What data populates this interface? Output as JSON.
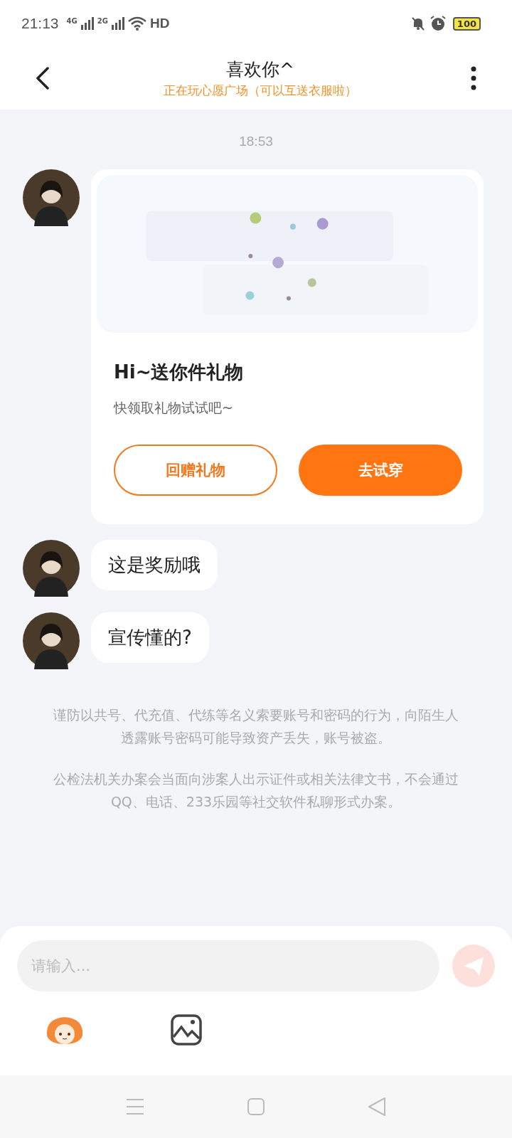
{
  "status_bar": {
    "time": "21:13",
    "signal_1": "4G",
    "signal_2": "2G",
    "network": "HD",
    "battery": "100"
  },
  "header": {
    "title": "喜欢你^",
    "subtitle": "正在玩心愿广场（可以互送衣服啦）"
  },
  "timestamp": "18:53",
  "messages": [
    {
      "kind": "gift",
      "image": {
        "kind": "picture"
      },
      "title": "Hi~送你件礼物",
      "text": "快领取礼物试试吧~",
      "buttons": [
        {
          "label": "回赠礼物",
          "kind": "outline"
        },
        {
          "label": "去试穿",
          "kind": "filled"
        }
      ]
    },
    {
      "kind": "text",
      "text": "这是奖励哦"
    },
    {
      "kind": "text",
      "text": "宣传懂的?"
    }
  ],
  "notices": [
    "谨防以共号、代充值、代练等名义索要账号和密码的行为，向陌生人透露账号密码可能导致资产丢失，账号被盗。",
    "公检法机关办案会当面向涉案人出示证件或相关法律文书，不会通过QQ、电话、233乐园等社交软件私聊形式办案。"
  ],
  "input": {
    "placeholder": "请输入..."
  }
}
